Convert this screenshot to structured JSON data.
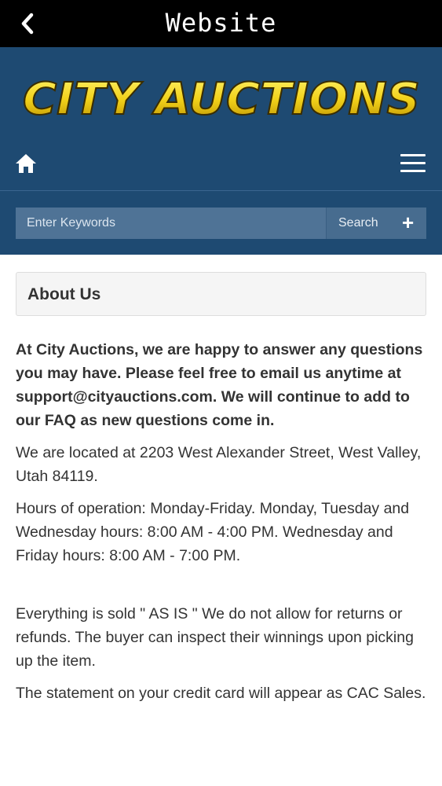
{
  "topbar": {
    "title": "Website",
    "back_icon": "chevron-left-icon"
  },
  "header": {
    "logo_text": "CITY AUCTIONS",
    "home_icon": "home-icon",
    "menu_icon": "hamburger-menu-icon",
    "bg_color": "#1e4a72",
    "logo_color": "#f2d11a"
  },
  "search": {
    "placeholder": "Enter Keywords",
    "button_label": "Search",
    "button_icon": "plus-icon"
  },
  "panel": {
    "title": "About Us"
  },
  "content": {
    "intro": "At City Auctions, we are happy to answer any questions you may have. Please feel free to email us anytime at support@cityauctions.com. We will continue to add to our FAQ as new questions come in.",
    "location": "We are located at 2203 West Alexander Street, West Valley, Utah 84119.",
    "hours": "Hours of operation: Monday-Friday. Monday, Tuesday and Wednesday hours: 8:00 AM - 4:00 PM. Wednesday and Friday hours: 8:00 AM - 7:00 PM.",
    "as_is": "Everything is sold \" AS IS \" We do not allow for returns or refunds. The buyer can inspect their winnings upon picking up the item.",
    "statement": "The statement on your credit card will appear as CAC Sales."
  }
}
